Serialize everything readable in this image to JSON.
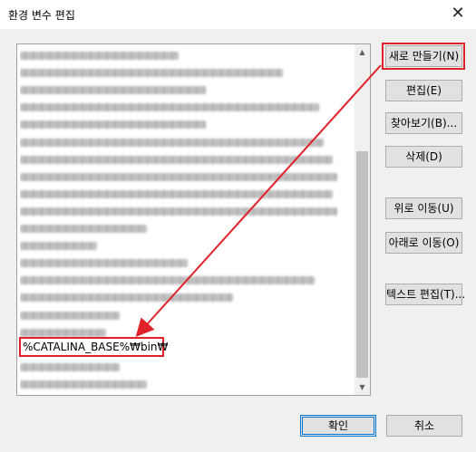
{
  "dialog": {
    "title": "환경 변수 편집",
    "close_glyph": "✕"
  },
  "env_list": {
    "rows": [
      {
        "text": "",
        "blur_width": 175
      },
      {
        "text": "",
        "blur_width": 290
      },
      {
        "text": "",
        "blur_width": 205
      },
      {
        "text": "",
        "blur_width": 330
      },
      {
        "text": "",
        "blur_width": 205
      },
      {
        "text": "",
        "blur_width": 335
      },
      {
        "text": "",
        "blur_width": 345
      },
      {
        "text": "",
        "blur_width": 350
      },
      {
        "text": "",
        "blur_width": 345
      },
      {
        "text": "",
        "blur_width": 350
      },
      {
        "text": "",
        "blur_width": 140
      },
      {
        "text": "",
        "blur_width": 85
      },
      {
        "text": "",
        "blur_width": 185
      },
      {
        "text": "",
        "blur_width": 325
      },
      {
        "text": "",
        "blur_width": 235
      },
      {
        "text": "",
        "blur_width": 110
      },
      {
        "text": "",
        "blur_width": 95
      },
      {
        "text": "%CATALINA_BASE%₩bin₩",
        "blur_width": 0
      },
      {
        "text": "",
        "blur_width": 110
      },
      {
        "text": "",
        "blur_width": 140
      }
    ],
    "selected_entry": "%CATALINA_BASE%₩bin₩"
  },
  "buttons": {
    "new": "새로 만들기(N)",
    "edit": "편집(E)",
    "browse": "찾아보기(B)...",
    "delete": "삭제(D)",
    "move_up": "위로 이동(U)",
    "move_down": "아래로 이동(O)",
    "edit_text": "텍스트 편집(T)...",
    "ok": "확인",
    "cancel": "취소"
  },
  "colors": {
    "highlight_red": "#e0212a",
    "default_button_border": "#0078d7"
  }
}
